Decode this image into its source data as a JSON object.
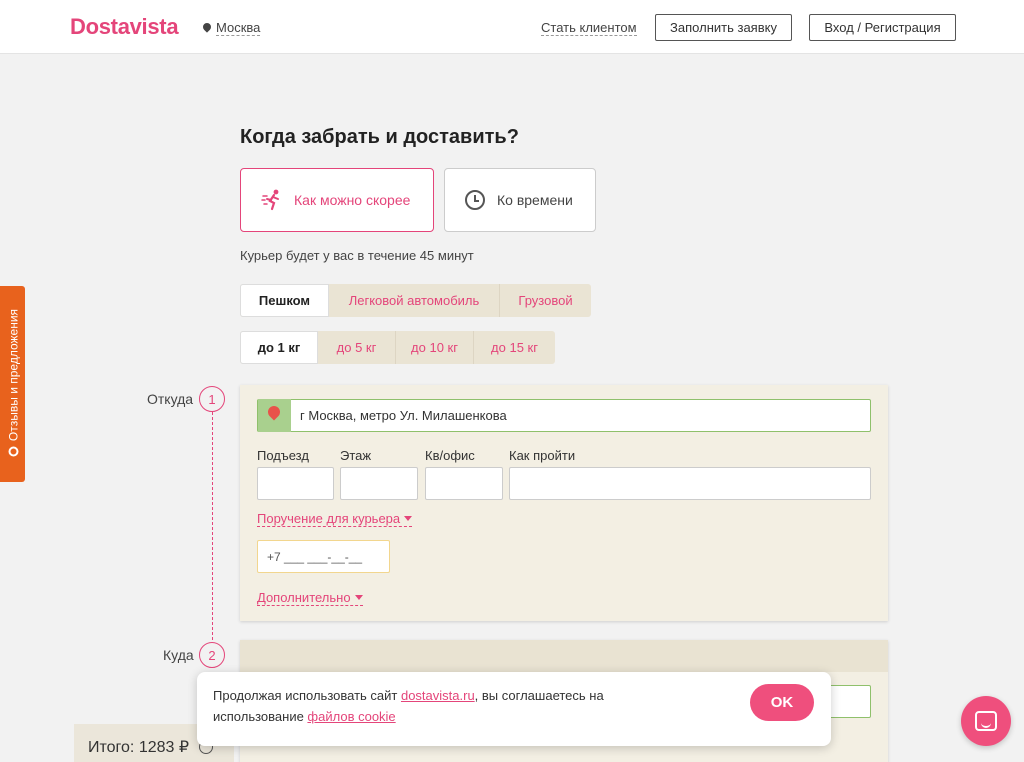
{
  "header": {
    "logo": "Dostavista",
    "city": "Москва",
    "become_client": "Стать клиентом",
    "fill_request": "Заполнить заявку",
    "login": "Вход / Регистрация"
  },
  "feedback_tab": "Отзывы и предложения",
  "title": "Когда забрать и доставить?",
  "timing": {
    "asap": "Как можно скорее",
    "scheduled": "Ко времени",
    "eta": "Курьер будет у вас в течение 45 минут"
  },
  "transport": [
    "Пешком",
    "Легковой автомобиль",
    "Грузовой"
  ],
  "weights": [
    "до 1 кг",
    "до 5 кг",
    "до 10 кг",
    "до 15 кг"
  ],
  "from": {
    "label": "Откуда",
    "num": "1",
    "address": "г Москва, метро Ул. Милашенкова",
    "fields": [
      "Подъезд",
      "Этаж",
      "Кв/офис",
      "Как пройти"
    ],
    "courier_task": "Поручение для курьера",
    "phone_placeholder": "+7 ___ ___-__-__",
    "more": "Дополнительно"
  },
  "to": {
    "label": "Куда",
    "num": "2"
  },
  "total": "Итого: 1283 ₽",
  "cookie": {
    "text1": "Продолжая использовать сайт ",
    "site": "dostavista.ru",
    "text2": ", вы соглашаетесь на использование ",
    "files": "файлов cookie",
    "ok": "OK"
  },
  "colors": {
    "brand": "#e4457a",
    "feedback": "#e8621d",
    "card": "#f3efe3"
  },
  "icons": {
    "chat": "chat-icon",
    "runner": "runner-icon",
    "clock": "clock-icon"
  }
}
